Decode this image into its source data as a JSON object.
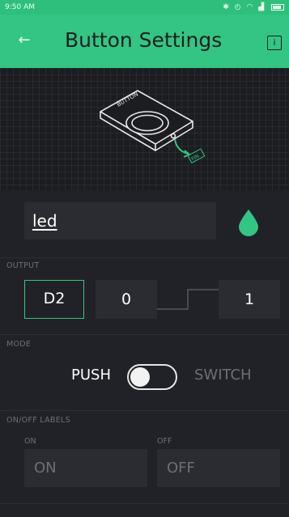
{
  "status_bar": {
    "time": "9:50 AM",
    "icons": [
      "bluetooth-icon",
      "alarm-icon",
      "wifi-icon",
      "signal-icon",
      "battery-icon"
    ]
  },
  "header": {
    "title": "Button Settings",
    "back_icon": "back-arrow-icon",
    "info_label": "i"
  },
  "preview": {
    "device_label": "BUTTON",
    "pin_label": "PIN"
  },
  "name": {
    "value": "led",
    "color": "#33c583"
  },
  "output": {
    "section_label": "OUTPUT",
    "pin": "D2",
    "min": "0",
    "max": "1"
  },
  "mode": {
    "section_label": "MODE",
    "push_label": "PUSH",
    "switch_label": "SWITCH",
    "selected": "PUSH"
  },
  "labels": {
    "section_label": "ON/OFF LABELS",
    "on_caption": "ON",
    "off_caption": "OFF",
    "on_placeholder": "ON",
    "off_placeholder": "OFF"
  },
  "colors": {
    "accent": "#33c583",
    "background": "#212227",
    "field": "#2b2c31"
  }
}
